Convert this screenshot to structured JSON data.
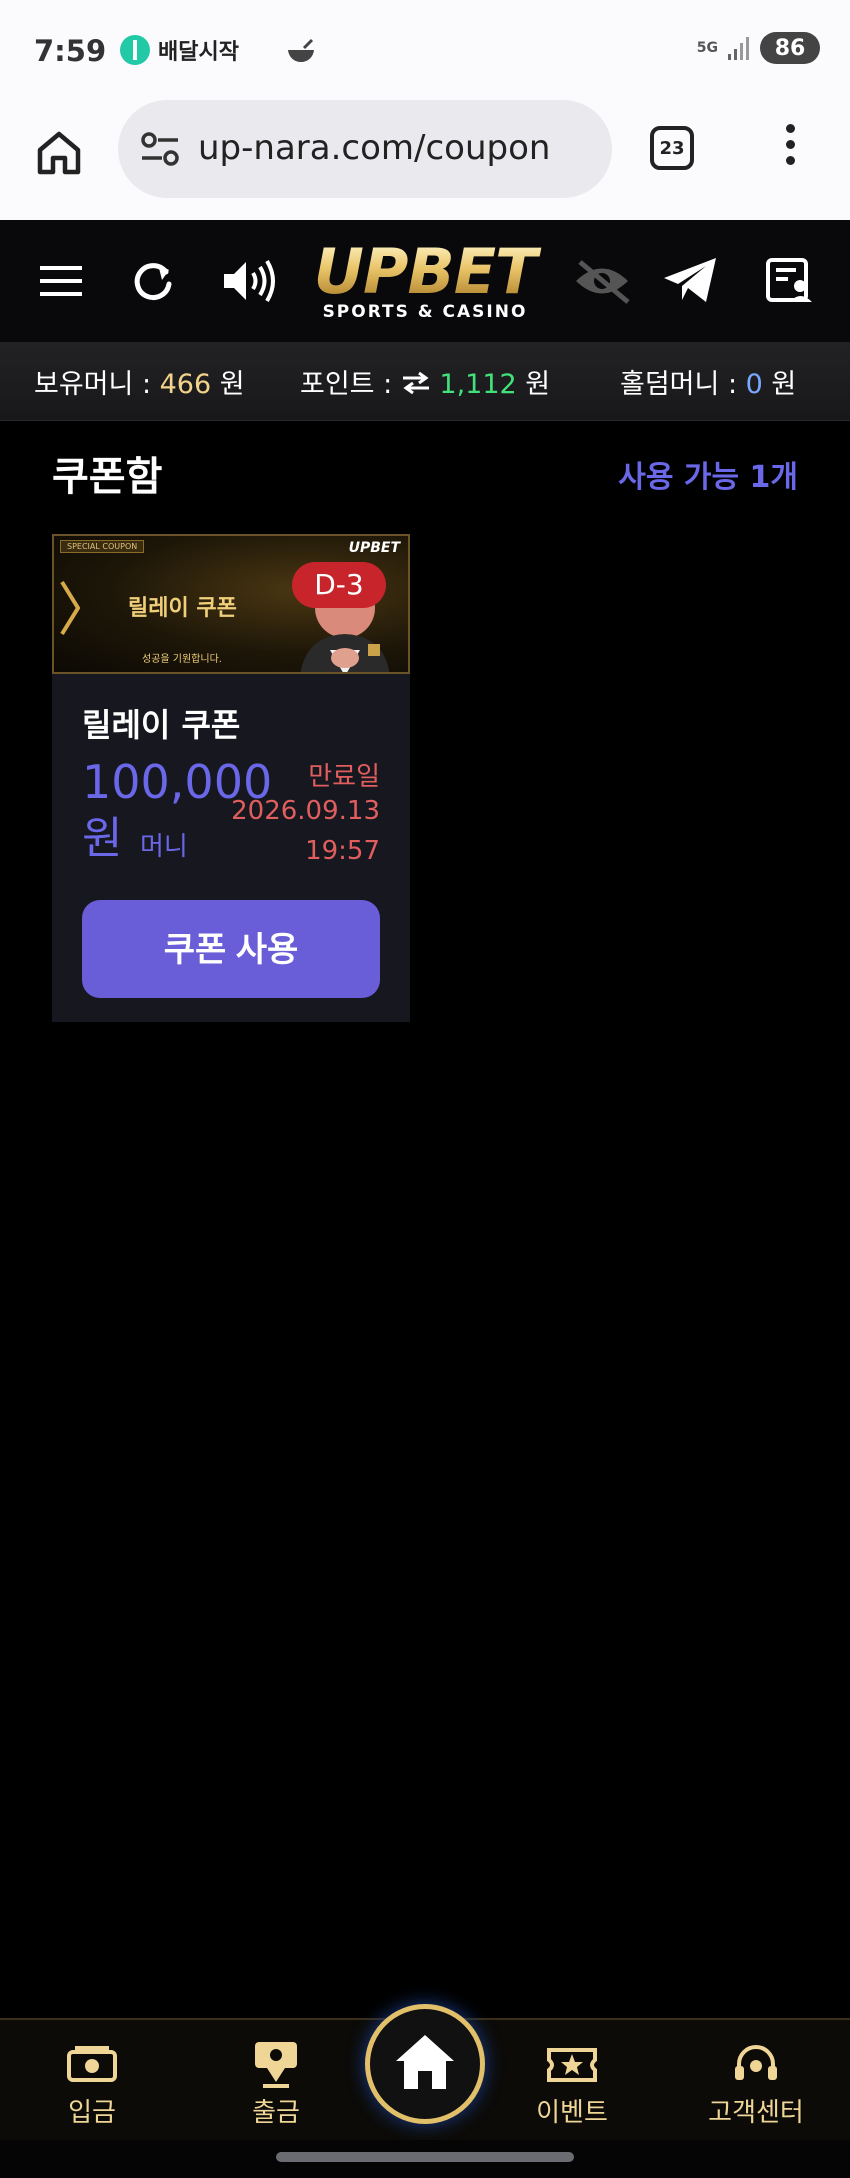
{
  "status_bar": {
    "time": "7:59",
    "app_label": "배달시작",
    "network": "5G",
    "battery": "86",
    "icons": [
      "app-notification-icon",
      "bowl-icon",
      "signal-icon"
    ]
  },
  "browser": {
    "url": "up-nara.com/coupon",
    "tab_count": "23",
    "icons": [
      "home-icon",
      "site-settings-icon",
      "more-menu-icon"
    ]
  },
  "header": {
    "logo_main": "UPBET",
    "logo_sub": "SPORTS & CASINO",
    "icons": [
      "hamburger-menu-icon",
      "refresh-icon",
      "speaker-icon",
      "mute-eye-icon",
      "telegram-icon",
      "profile-card-icon"
    ]
  },
  "money": {
    "held_label": "보유머니 : ",
    "held_value": "466",
    "held_unit": " 원",
    "point_label": "포인트 : ",
    "point_value": "1,112",
    "point_unit": " 원",
    "holdem_label": "홀덤머니 : ",
    "holdem_value": "0",
    "holdem_unit": " 원"
  },
  "coupon_section": {
    "title": "쿠폰함",
    "available": "사용 가능 1개"
  },
  "coupon": {
    "banner_tag": "SPECIAL COUPON",
    "banner_logo": "UPBET",
    "banner_title": "릴레이 쿠폰",
    "banner_sub": "성공을 기원합니다.",
    "d_day": "D-3",
    "name": "릴레이 쿠폰",
    "amount": "100,000",
    "amount_unit": "원",
    "amount_type": "머니",
    "expiry_label": "만료일",
    "expiry_date": "2026.09.13",
    "expiry_time": "19:57",
    "use_button": "쿠폰 사용"
  },
  "bottom_nav": {
    "deposit": "입금",
    "withdraw": "출금",
    "event": "이벤트",
    "support": "고객센터"
  },
  "colors": {
    "accent_purple": "#6a67e8",
    "gold": "#efd596",
    "green": "#42e27a",
    "expiry_red": "#e15e5e"
  }
}
